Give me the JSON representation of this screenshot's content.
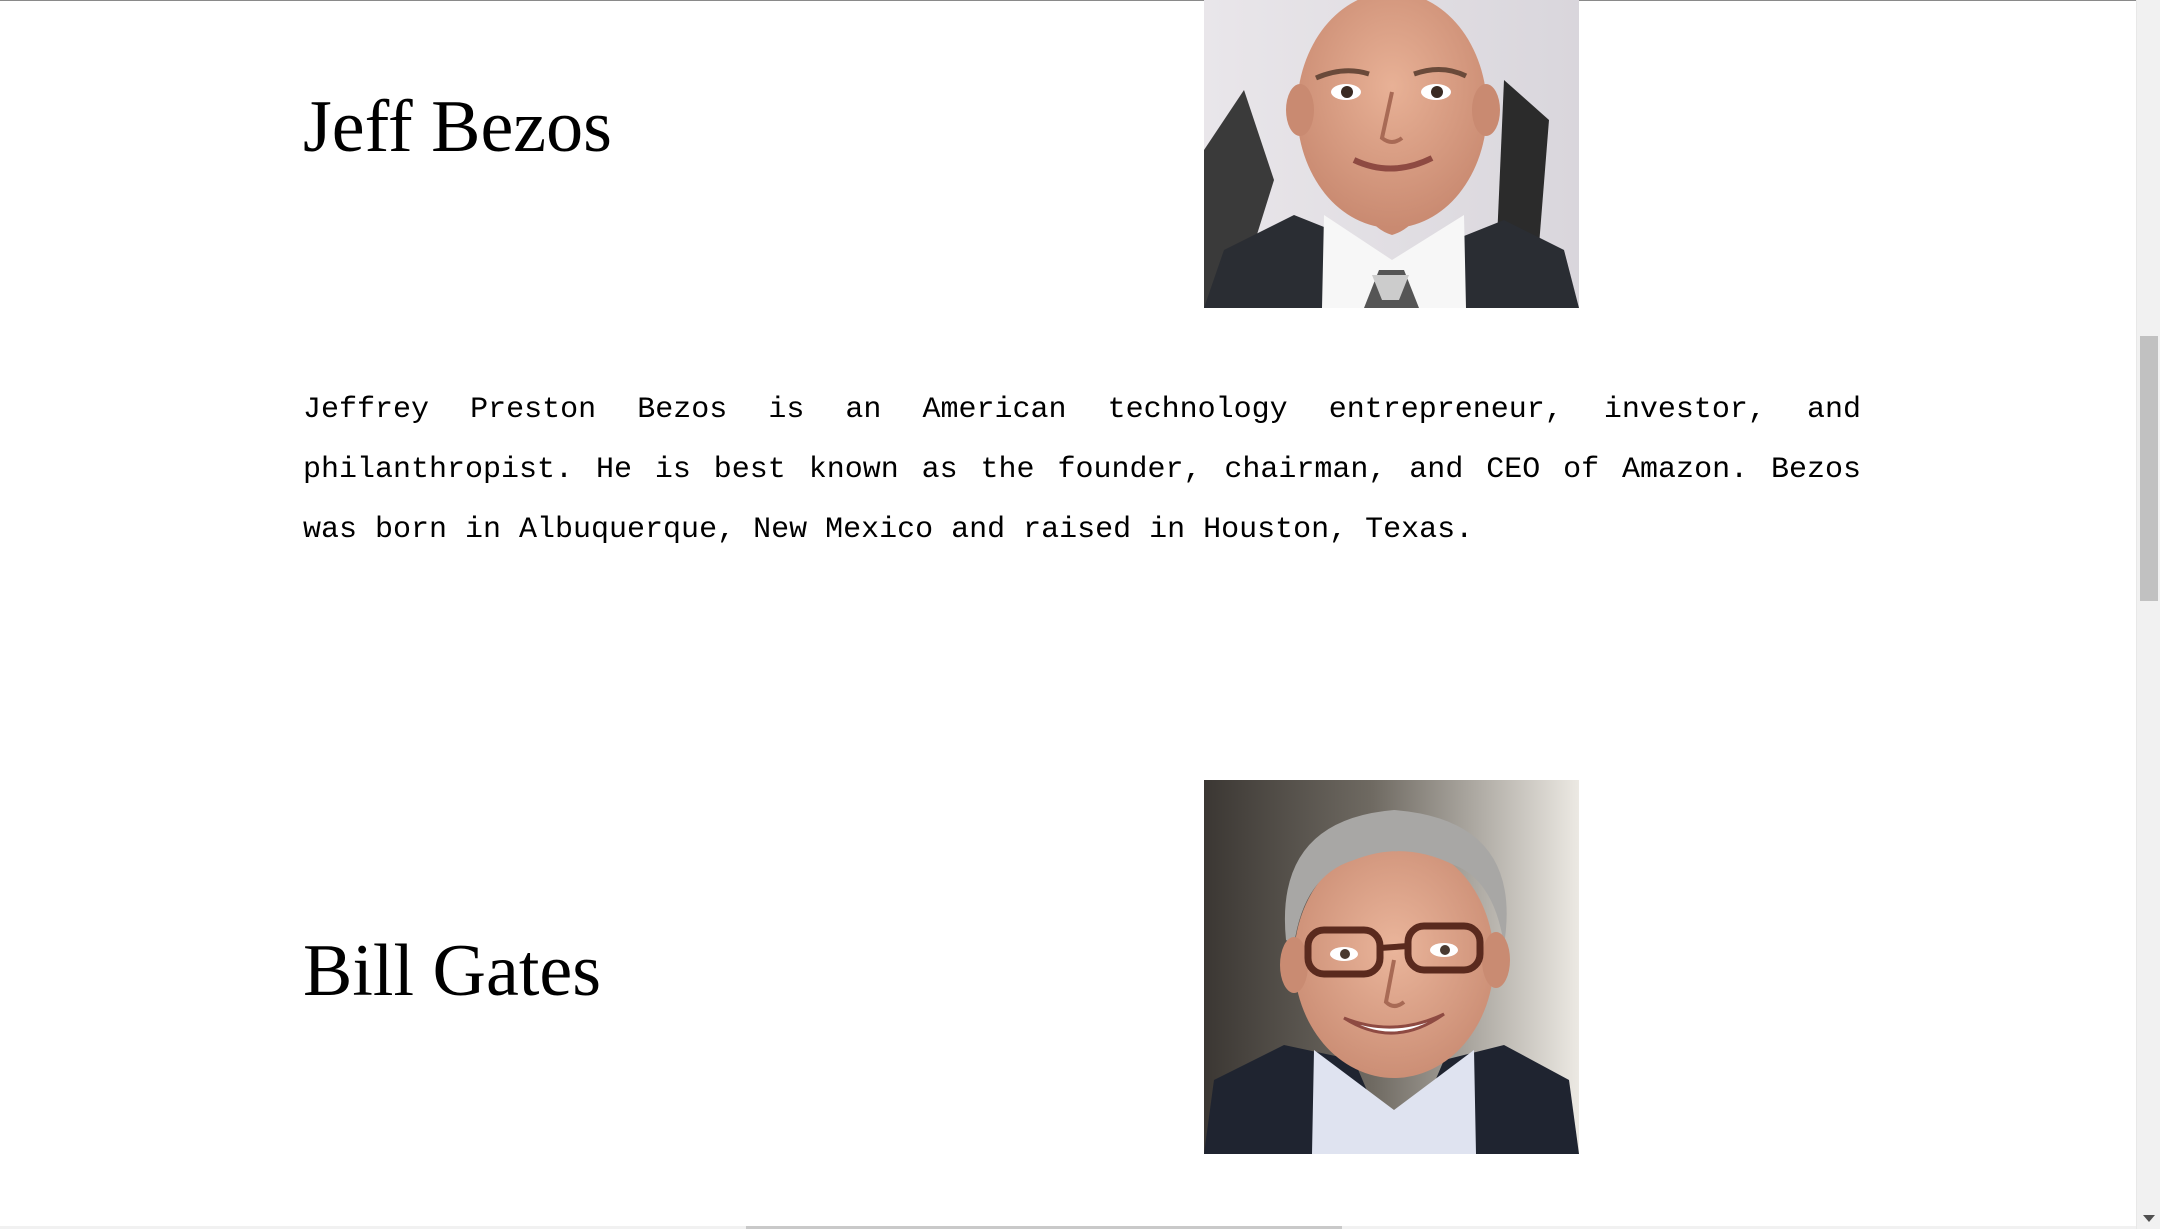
{
  "people": [
    {
      "name": "Jeff Bezos",
      "image_alt": "Jeff Bezos portrait",
      "bio": "Jeffrey Preston Bezos is an American technology entrepreneur, investor, and philanthropist. He is best known as the founder, chairman, and CEO of Amazon. Bezos was born in Albuquerque, New Mexico and raised in Houston, Texas."
    },
    {
      "name": "Bill Gates",
      "image_alt": "Bill Gates portrait"
    }
  ],
  "colors": {
    "text": "#000000",
    "background": "#ffffff",
    "scrollbar_track": "#f1f1f1",
    "scrollbar_thumb": "#c1c1c1"
  },
  "icons": {
    "scroll_down": "chevron-down-icon"
  }
}
